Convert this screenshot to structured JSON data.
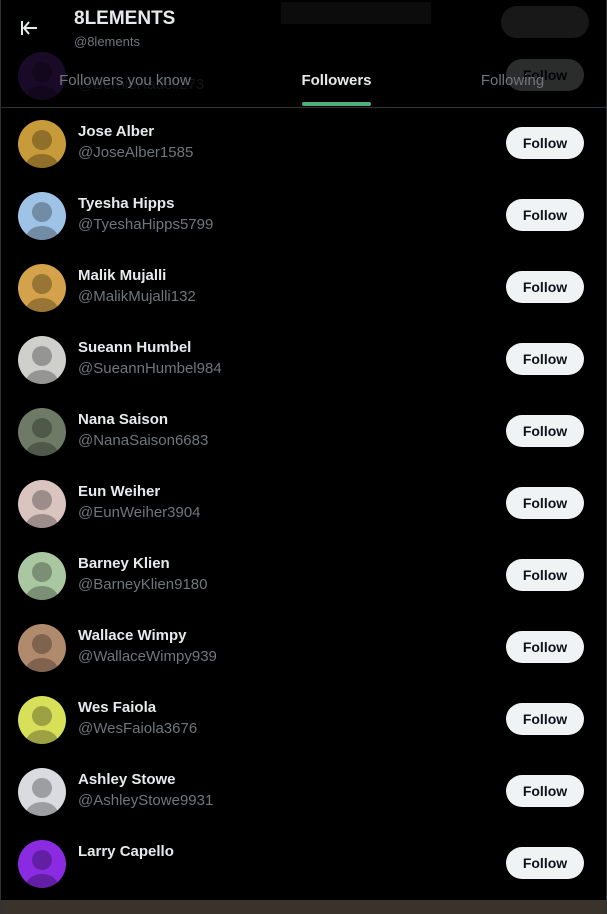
{
  "header": {
    "title": "8LEMENTS",
    "handle": "@8lements",
    "tabs": [
      {
        "label": "Followers you know"
      },
      {
        "label": "Followers"
      },
      {
        "label": "Following"
      }
    ]
  },
  "follow_label": "Follow",
  "followers": [
    {
      "name": "",
      "handle": "@BernieRadell273",
      "avatar_color": "#8a3bd6"
    },
    {
      "name": "Jose Alber",
      "handle": "@JoseAlber1585",
      "avatar_color": "#c79a3a"
    },
    {
      "name": "Tyesha Hipps",
      "handle": "@TyeshaHipps5799",
      "avatar_color": "#9ec3e6"
    },
    {
      "name": "Malik Mujalli",
      "handle": "@MalikMujalli132",
      "avatar_color": "#d4a24a"
    },
    {
      "name": "Sueann Humbel",
      "handle": "@SueannHumbel984",
      "avatar_color": "#cfd0cc"
    },
    {
      "name": "Nana Saison",
      "handle": "@NanaSaison6683",
      "avatar_color": "#6f7a66"
    },
    {
      "name": "Eun Weiher",
      "handle": "@EunWeiher3904",
      "avatar_color": "#d9c4c0"
    },
    {
      "name": "Barney Klien",
      "handle": "@BarneyKlien9180",
      "avatar_color": "#a9c7a0"
    },
    {
      "name": "Wallace Wimpy",
      "handle": "@WallaceWimpy939",
      "avatar_color": "#b08a6c"
    },
    {
      "name": "Wes Faiola",
      "handle": "@WesFaiola3676",
      "avatar_color": "#d8e05a"
    },
    {
      "name": "Ashley Stowe",
      "handle": "@AshleyStowe9931",
      "avatar_color": "#d9dbe0"
    },
    {
      "name": "Larry Capello",
      "handle": "",
      "avatar_color": "#8a2be2"
    }
  ]
}
